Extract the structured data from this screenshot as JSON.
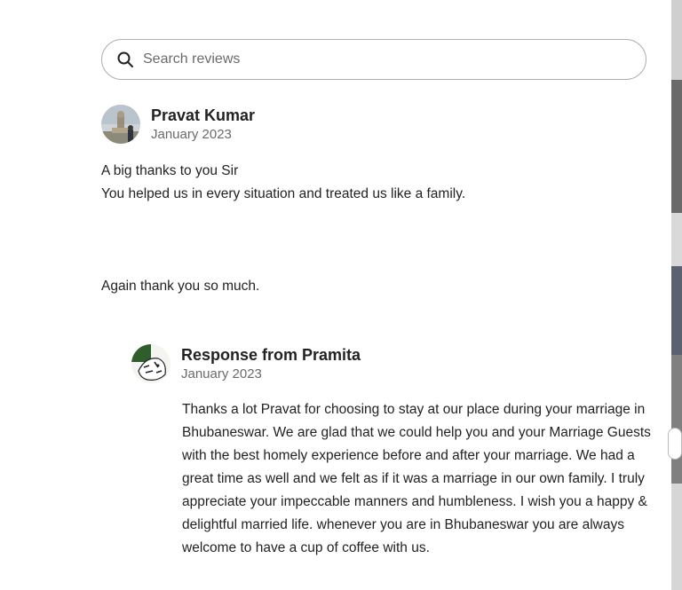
{
  "search": {
    "placeholder": "Search reviews",
    "icon": "search-icon"
  },
  "review": {
    "author": "Pravat Kumar",
    "date": "January 2023",
    "lines": [
      "A big thanks to you Sir",
      "You helped us in every situation and treated us like a family.",
      "Again thank you so much."
    ]
  },
  "response": {
    "title": "Response from Pramita",
    "date": "January 2023",
    "text": "Thanks a lot Pravat for choosing to stay at our place during your marriage in Bhubaneswar. We are glad that we could help you and your Marriage Guests with the best homely experience before and after your marriage. We had a great time as well and we felt as if it was a marriage in our own family. I truly appreciate your impeccable manners and humbleness. I wish you a happy & delightful married life. whenever you are in Bhubaneswar you are always welcome to have a cup of coffee with us."
  },
  "colors": {
    "text": "#222222",
    "muted": "#6a6a6a",
    "border": "#b0b0b0"
  }
}
